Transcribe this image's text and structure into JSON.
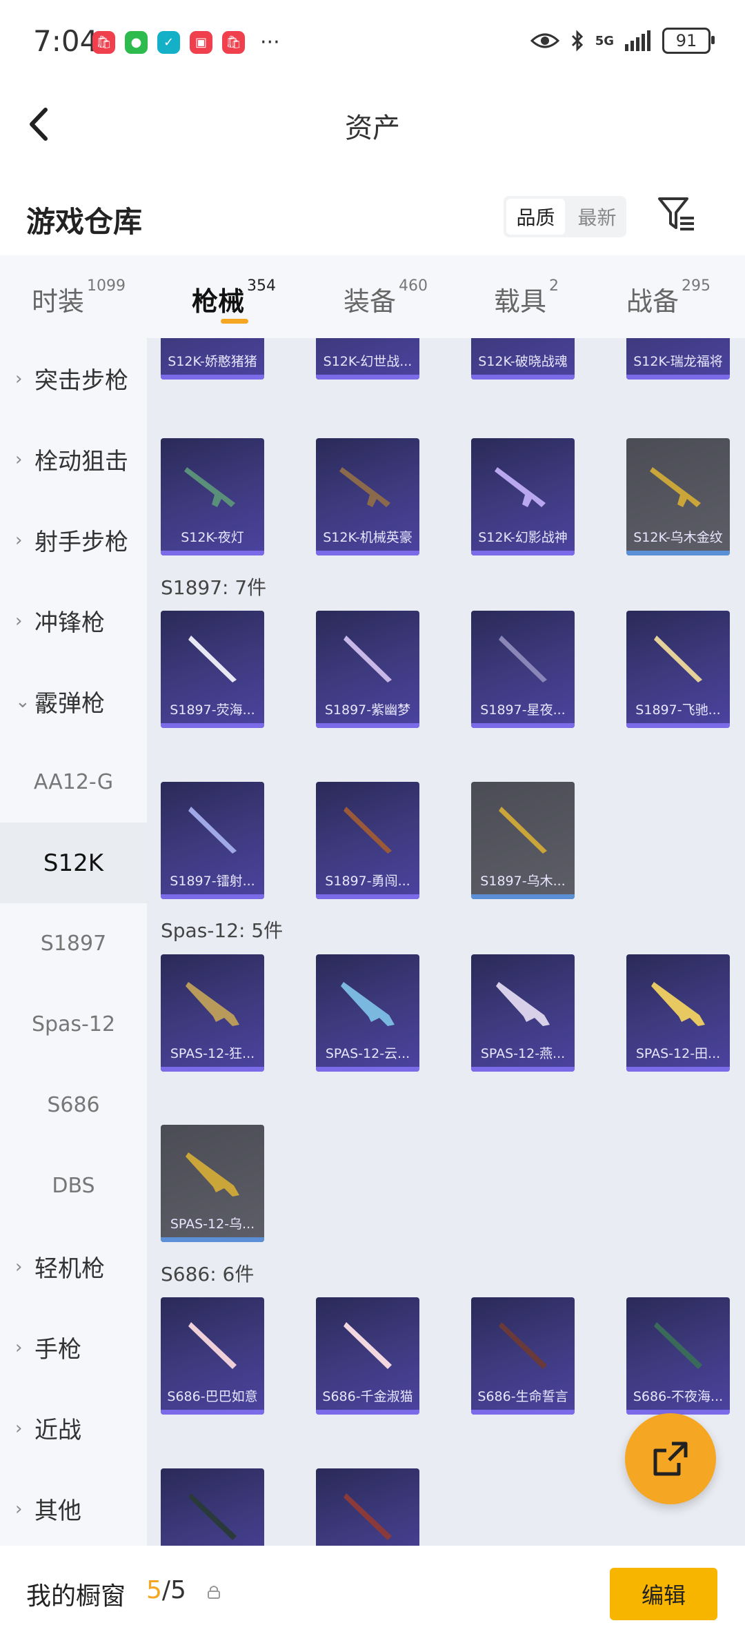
{
  "status_bar": {
    "time": "7:04",
    "network": "5G",
    "battery": "91",
    "apps": [
      {
        "icon": "shopping-bag-icon",
        "color": "#f0404e"
      },
      {
        "icon": "wechat-icon",
        "color": "#2dbb4e"
      },
      {
        "icon": "shield-icon",
        "color": "#14b0c8"
      },
      {
        "icon": "gift-box-icon",
        "color": "#f0404e"
      },
      {
        "icon": "shopping-bag-icon",
        "color": "#f0404e"
      }
    ],
    "more": "···"
  },
  "header": {
    "title": "资产"
  },
  "section": {
    "title": "游戏仓库",
    "sort_options": [
      "品质",
      "最新"
    ],
    "sort_active": "品质"
  },
  "tabs": [
    {
      "label": "时装",
      "count": "1099"
    },
    {
      "label": "枪械",
      "count": "354",
      "active": true
    },
    {
      "label": "装备",
      "count": "460"
    },
    {
      "label": "载具",
      "count": "2"
    },
    {
      "label": "战备",
      "count": "295"
    }
  ],
  "sidebar": {
    "categories": [
      {
        "label": "突击步枪"
      },
      {
        "label": "栓动狙击"
      },
      {
        "label": "射手步枪"
      },
      {
        "label": "冲锋枪"
      },
      {
        "label": "霰弹枪",
        "expanded": true
      },
      {
        "label": "轻机枪"
      },
      {
        "label": "手枪"
      },
      {
        "label": "近战"
      },
      {
        "label": "其他"
      }
    ],
    "shotgun_subs": [
      "AA12-G",
      "S12K",
      "S1897",
      "Spas-12",
      "S686",
      "DBS"
    ],
    "active_sub": "S12K"
  },
  "groups": {
    "s12k_row_top": [
      "S12K-娇憨猪猪",
      "S12K-幻世战...",
      "S12K-破晓战魂",
      "S12K-瑞龙福将"
    ],
    "s12k_row2": [
      "S12K-夜灯",
      "S12K-机械英豪",
      "S12K-幻影战神",
      "S12K-乌木金纹"
    ],
    "s1897_title": "S1897: 7件",
    "s1897_row1": [
      "S1897-荧海...",
      "S1897-紫幽梦",
      "S1897-星夜...",
      "S1897-飞驰..."
    ],
    "s1897_row2": [
      "S1897-镭射...",
      "S1897-勇闯...",
      "S1897-乌木..."
    ],
    "spas_title": "Spas-12: 5件",
    "spas_row1": [
      "SPAS-12-狂...",
      "SPAS-12-云...",
      "SPAS-12-燕...",
      "SPAS-12-田..."
    ],
    "spas_row2": [
      "SPAS-12-乌..."
    ],
    "s686_title": "S686: 6件",
    "s686_row1": [
      "S686-巴巴如意",
      "S686-千金淑猫",
      "S686-生命誓言",
      "S686-不夜海..."
    ]
  },
  "bottom": {
    "showcase_label": "我的橱窗",
    "showcase_current": "5",
    "showcase_total": "/5",
    "edit_label": "编辑"
  },
  "colors": {
    "accent": "#f5a623",
    "card_purple": "#3e3a7e",
    "card_gray": "#5d5e67"
  }
}
